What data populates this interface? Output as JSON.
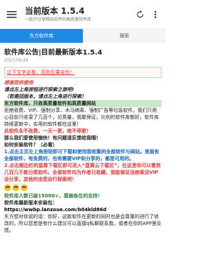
{
  "appbar": {
    "title": "当前版本 1.5.4",
    "subtitle": "一款只分享精品软件的高质量软件库"
  },
  "tabs": [
    {
      "label": "东方软件库"
    },
    {
      "label": "搜索"
    }
  ],
  "post": {
    "title": "软件库公告|目前最新版本1.5.4",
    "date": "2023-09-29",
    "lines": {
      "warning": "以下文字必看，否则后果自负！",
      "thanks": "感谢您的使用",
      "explore": "请点左上角按钮进行探索之旅吧!",
      "explore_paren": "（若是回版本，请点左上角进行探索）",
      "intro": "东方软件库，只收高质量软件和高质量网站",
      "refuse": "拒绝收费、VIP、强制分享、木马病毒、强制广告等垃圾软件。我们只用心目前只收录了几百个，论质量，我敢保证，比别的软件库都好，软件库持续更新中，实用的软件都在这里！",
      "quality": "此软件永不收费，一天一更，绝不停更！",
      "question": "那么我们爱使用愉快！有问题请反馈给我哦！",
      "howto_title": "如何安装软件？（必看）",
      "step1": "1.点击主页左上角按钮即可下载和使用我收集的全部软件与网站。里面有全部软件，有免费的，也有需要VIP和分享的，都是可用的。",
      "step2": "2.点击侧边栏的蓝奏下载区即可进入“蓝奏云下载区”，在这里你可以看到几百几千款分类软件。全部软件均为作者已收藏，我能保证没病毒没VIP没分享，其他的由您自行探索吧！",
      "users": "软件库人数已破15000+，感谢各位的支持！",
      "latest_label": "软件库最新版本安装包：",
      "link": "https://wwbp.lanzoue.com/b04kld86d",
      "thanks_note": "东方想对你说的话：你好，这款软件在更新的同时也是会尊重的进行了修改的，所以您若是有什么建议可以直接q私聊联系我，或者在你的APP里反馈。"
    }
  },
  "icons": {
    "menu": "hamburger-menu-icon",
    "refresh": "refresh-icon",
    "more": "more-vert-icon"
  },
  "colors": {
    "accent": "#1e88e5",
    "warning": "#e53935",
    "green": "#2e7d32"
  }
}
